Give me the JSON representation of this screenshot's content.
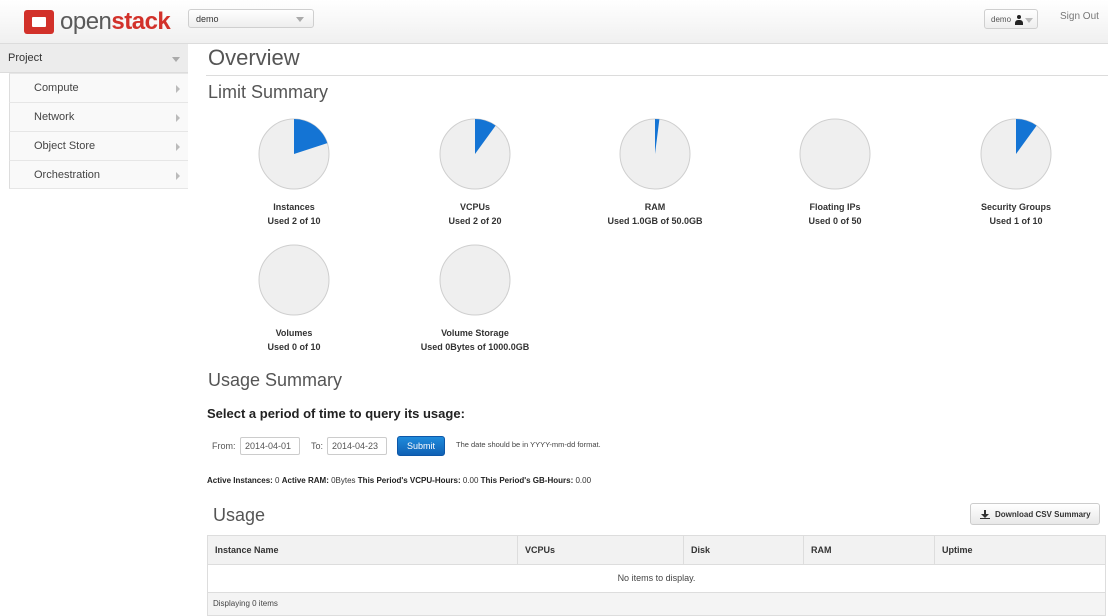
{
  "header": {
    "logo_open": "open",
    "logo_stack": "stack",
    "project_selected": "demo",
    "user_label": "demo",
    "signout_label": "Sign Out"
  },
  "sidebar": {
    "section": "Project",
    "items": [
      {
        "label": "Compute"
      },
      {
        "label": "Network"
      },
      {
        "label": "Object Store"
      },
      {
        "label": "Orchestration"
      }
    ]
  },
  "main": {
    "title": "Overview",
    "limit_heading": "Limit Summary",
    "limits": [
      {
        "name": "Instances",
        "used_text": "Used 2 of 10",
        "fraction": 0.2
      },
      {
        "name": "VCPUs",
        "used_text": "Used 2 of 20",
        "fraction": 0.1
      },
      {
        "name": "RAM",
        "used_text": "Used 1.0GB of 50.0GB",
        "fraction": 0.02
      },
      {
        "name": "Floating IPs",
        "used_text": "Used 0 of 50",
        "fraction": 0
      },
      {
        "name": "Security Groups",
        "used_text": "Used 1 of 10",
        "fraction": 0.1
      },
      {
        "name": "Volumes",
        "used_text": "Used 0 of 10",
        "fraction": 0
      },
      {
        "name": "Volume Storage",
        "used_text": "Used 0Bytes of 1000.0GB",
        "fraction": 0
      }
    ],
    "usage_heading": "Usage Summary",
    "period_heading": "Select a period of time to query its usage:",
    "form": {
      "from_label": "From:",
      "from_value": "2014-04-01",
      "to_label": "To:",
      "to_value": "2014-04-23",
      "submit_label": "Submit",
      "hint": "The date should be in YYYY-mm-dd format."
    },
    "stats": {
      "active_instances_label": "Active Instances:",
      "active_instances_value": "0",
      "active_ram_label": "Active RAM:",
      "active_ram_value": "0Bytes",
      "vcpu_hours_label": "This Period's VCPU-Hours:",
      "vcpu_hours_value": "0.00",
      "gb_hours_label": "This Period's GB-Hours:",
      "gb_hours_value": "0.00"
    },
    "usage_table": {
      "title": "Usage",
      "csv_button": "Download CSV Summary",
      "columns": [
        "Instance Name",
        "VCPUs",
        "Disk",
        "RAM",
        "Uptime"
      ],
      "empty_text": "No items to display.",
      "footer": "Displaying 0 items"
    }
  },
  "colors": {
    "pie_fill": "#1474d4",
    "pie_bg": "#efefef",
    "pie_border": "#cfcfcf"
  }
}
